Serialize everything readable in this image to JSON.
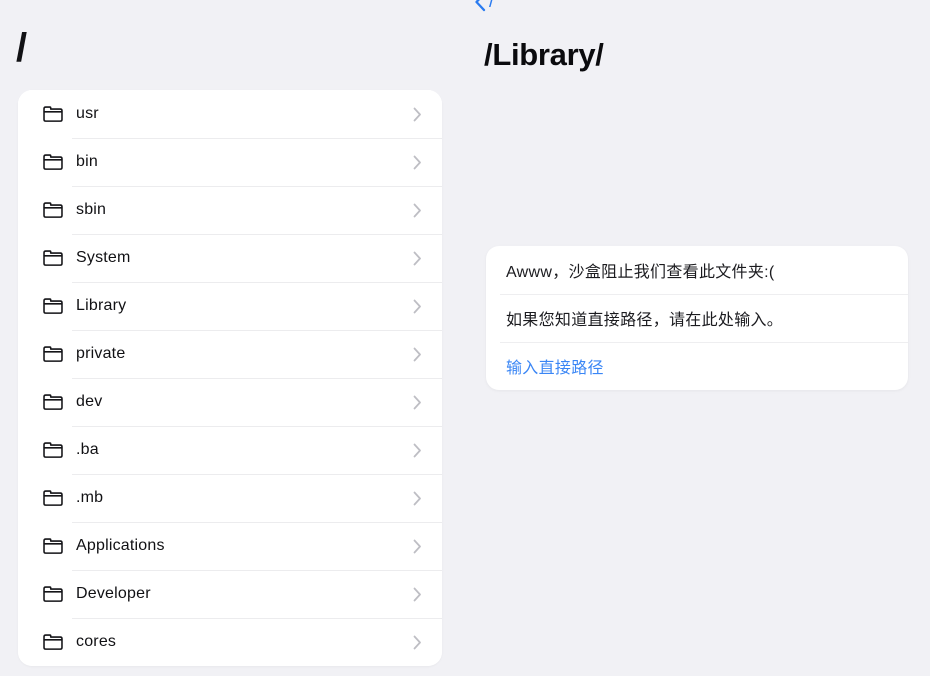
{
  "left_panel": {
    "title": "/",
    "folders": [
      {
        "name": "usr",
        "icon": "folder-icon",
        "accessory": "chevron-right-icon"
      },
      {
        "name": "bin",
        "icon": "folder-icon",
        "accessory": "chevron-right-icon"
      },
      {
        "name": "sbin",
        "icon": "folder-icon",
        "accessory": "chevron-right-icon"
      },
      {
        "name": "System",
        "icon": "folder-icon",
        "accessory": "chevron-right-icon"
      },
      {
        "name": "Library",
        "icon": "folder-icon",
        "accessory": "chevron-right-icon"
      },
      {
        "name": "private",
        "icon": "folder-icon",
        "accessory": "chevron-right-icon"
      },
      {
        "name": "dev",
        "icon": "folder-icon",
        "accessory": "chevron-right-icon"
      },
      {
        "name": ".ba",
        "icon": "folder-icon",
        "accessory": "chevron-right-icon"
      },
      {
        "name": ".mb",
        "icon": "folder-icon",
        "accessory": "chevron-right-icon"
      },
      {
        "name": "Applications",
        "icon": "folder-icon",
        "accessory": "chevron-right-icon"
      },
      {
        "name": "Developer",
        "icon": "folder-icon",
        "accessory": "chevron-right-icon"
      },
      {
        "name": "cores",
        "icon": "folder-icon",
        "accessory": "chevron-right-icon"
      }
    ]
  },
  "right_panel": {
    "back_button": {
      "label": "/",
      "icon": "chevron-left-icon"
    },
    "title": "/Library/",
    "dialog": {
      "message": "Awww，沙盒阻止我们查看此文件夹:(",
      "hint": "如果您知道直接路径，请在此处输入。",
      "action_label": "输入直接路径"
    }
  },
  "colors": {
    "background": "#F1F1F5",
    "card": "#FFFFFF",
    "text_primary": "#111114",
    "divider": "#ECECEE",
    "accent_blue": "#2A7BF0",
    "link_blue": "#3A86F5",
    "chevron_gray": "#BEBEC4"
  }
}
